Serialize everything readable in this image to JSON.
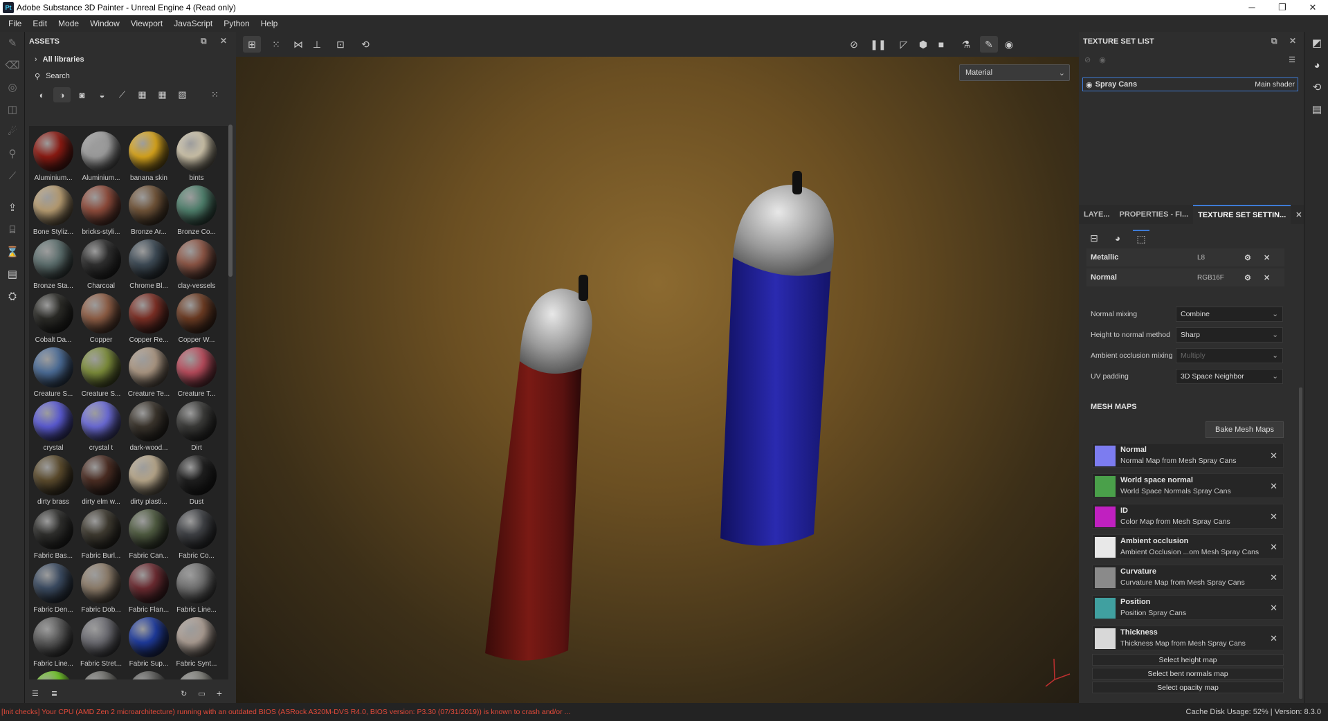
{
  "window": {
    "title": "Adobe Substance 3D Painter - Unreal Engine 4 (Read only)",
    "app_icon_text": "Pt"
  },
  "menu": [
    "File",
    "Edit",
    "Mode",
    "Window",
    "Viewport",
    "JavaScript",
    "Python",
    "Help"
  ],
  "assets": {
    "title": "ASSETS",
    "library": "All libraries",
    "search_placeholder": "Search",
    "items": [
      {
        "name": "Aluminium...",
        "color": "#8a1a12"
      },
      {
        "name": "Aluminium...",
        "color": "#9a9a9a"
      },
      {
        "name": "banana skin",
        "color": "#d4a21c"
      },
      {
        "name": "bints",
        "color": "#c9bfa6"
      },
      {
        "name": "Bone Styliz...",
        "color": "#b49a70"
      },
      {
        "name": "bricks-styli...",
        "color": "#8c4a3a"
      },
      {
        "name": "Bronze Ar...",
        "color": "#6e5237"
      },
      {
        "name": "Bronze Co...",
        "color": "#4d7d6a"
      },
      {
        "name": "Bronze Sta...",
        "color": "#5b6d6c"
      },
      {
        "name": "Charcoal",
        "color": "#2e2e2e"
      },
      {
        "name": "Chrome Bl...",
        "color": "#3d4a55"
      },
      {
        "name": "clay-vessels",
        "color": "#8a5444"
      },
      {
        "name": "Cobalt Da...",
        "color": "#2a2a26"
      },
      {
        "name": "Copper",
        "color": "#8c5c44"
      },
      {
        "name": "Copper Re...",
        "color": "#7a2e24"
      },
      {
        "name": "Copper W...",
        "color": "#6a3a22"
      },
      {
        "name": "Creature S...",
        "color": "#4a6a94"
      },
      {
        "name": "Creature S...",
        "color": "#7a8a3a"
      },
      {
        "name": "Creature Te...",
        "color": "#a89480"
      },
      {
        "name": "Creature T...",
        "color": "#b44a5a"
      },
      {
        "name": "crystal",
        "color": "#5a5ad0"
      },
      {
        "name": "crystal t",
        "color": "#6a6ad4"
      },
      {
        "name": "dark-wood...",
        "color": "#3a342c"
      },
      {
        "name": "Dirt",
        "color": "#3a3a38"
      },
      {
        "name": "dirty brass",
        "color": "#5a4a2c"
      },
      {
        "name": "dirty elm w...",
        "color": "#4a2c22"
      },
      {
        "name": "dirty plasti...",
        "color": "#b4a488"
      },
      {
        "name": "Dust",
        "color": "#1e1e1e"
      },
      {
        "name": "Fabric Bas...",
        "color": "#2e2e2c"
      },
      {
        "name": "Fabric Burl...",
        "color": "#3e3a30"
      },
      {
        "name": "Fabric Can...",
        "color": "#4e5a40"
      },
      {
        "name": "Fabric Co...",
        "color": "#3e4044"
      },
      {
        "name": "Fabric Den...",
        "color": "#3a4a60"
      },
      {
        "name": "Fabric Dob...",
        "color": "#8a7a68"
      },
      {
        "name": "Fabric Flan...",
        "color": "#6a2a30"
      },
      {
        "name": "Fabric Line...",
        "color": "#6e6e6e"
      },
      {
        "name": "Fabric Line...",
        "color": "#5a5a5a"
      },
      {
        "name": "Fabric Stret...",
        "color": "#6a6a70"
      },
      {
        "name": "Fabric Sup...",
        "color": "#1e3a9a"
      },
      {
        "name": "Fabric Synt...",
        "color": "#a89a90"
      },
      {
        "name": "",
        "color": "#6ac020"
      },
      {
        "name": "",
        "color": "#6a6a66"
      },
      {
        "name": "",
        "color": "#5a5a58"
      },
      {
        "name": "",
        "color": "#7a7a74"
      }
    ]
  },
  "viewport": {
    "material_mode": "Material"
  },
  "texture_set_list": {
    "title": "TEXTURE SET LIST",
    "set_name": "Spray Cans",
    "shader": "Main shader"
  },
  "tabs": [
    {
      "label": "LAYE...",
      "active": false
    },
    {
      "label": "PROPERTIES - FI...",
      "active": false
    },
    {
      "label": "TEXTURE SET SETTIN...",
      "active": true
    }
  ],
  "channels": [
    {
      "name": "Metallic",
      "format": "L8"
    },
    {
      "name": "Normal",
      "format": "RGB16F"
    }
  ],
  "settings": [
    {
      "label": "Normal mixing",
      "value": "Combine",
      "disabled": false
    },
    {
      "label": "Height to normal method",
      "value": "Sharp",
      "disabled": false
    },
    {
      "label": "Ambient occlusion mixing",
      "value": "Multiply",
      "disabled": true
    },
    {
      "label": "UV padding",
      "value": "3D Space Neighbor",
      "disabled": false
    }
  ],
  "mesh_maps": {
    "title": "MESH MAPS",
    "bake_label": "Bake Mesh Maps",
    "items": [
      {
        "name": "Normal",
        "sub": "Normal Map from Mesh Spray Cans",
        "thumb": "#7c7cf0"
      },
      {
        "name": "World space normal",
        "sub": "World Space Normals Spray Cans",
        "thumb": "#4aa04a"
      },
      {
        "name": "ID",
        "sub": "Color Map from Mesh Spray Cans",
        "thumb": "#c020c0"
      },
      {
        "name": "Ambient occlusion",
        "sub": "Ambient Occlusion ...om Mesh Spray Cans",
        "thumb": "#e8e8e8"
      },
      {
        "name": "Curvature",
        "sub": "Curvature Map from Mesh Spray Cans",
        "thumb": "#8a8a8a"
      },
      {
        "name": "Position",
        "sub": "Position Spray Cans",
        "thumb": "#40a0a0"
      },
      {
        "name": "Thickness",
        "sub": "Thickness Map from Mesh Spray Cans",
        "thumb": "#d8d8d8"
      }
    ],
    "select_buttons": [
      "Select height map",
      "Select bent normals map",
      "Select opacity map"
    ]
  },
  "status": {
    "warning": "[Init checks] Your CPU (AMD Zen 2 microarchitecture) running with an outdated BIOS (ASRock A320M-DVS R4.0, BIOS version: P3.30 (07/31/2019)) is known to crash and/or ...",
    "right": "Cache Disk Usage:  52% | Version: 8.3.0"
  }
}
